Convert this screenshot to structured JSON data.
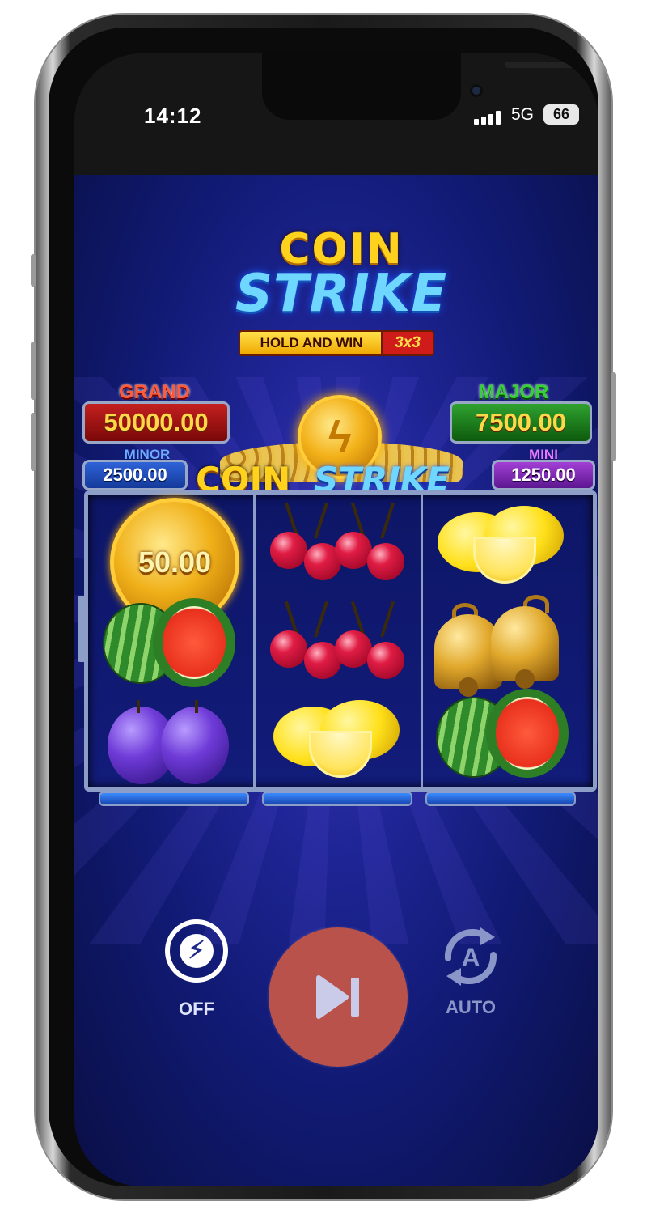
{
  "status_bar": {
    "time": "14:12",
    "network": "5G",
    "battery": "66"
  },
  "logo": {
    "word1": "COIN",
    "word2": "STRIKE",
    "tag": "HOLD AND WIN",
    "tag_badge": "3x3"
  },
  "jackpots": {
    "grand": {
      "label": "GRAND",
      "value": "50000.00"
    },
    "major": {
      "label": "MAJOR",
      "value": "7500.00"
    },
    "minor": {
      "label": "MINOR",
      "value": "2500.00"
    },
    "mini": {
      "label": "MINI",
      "value": "1250.00"
    }
  },
  "banner": {
    "word1": "COIN",
    "word2": "STRIKE"
  },
  "reels": [
    [
      "coin",
      "watermelon",
      "plums"
    ],
    [
      "cherries",
      "cherries",
      "lemons"
    ],
    [
      "lemons",
      "bells",
      "watermelon"
    ]
  ],
  "coin_value": "50.00",
  "controls": {
    "turbo_label": "OFF",
    "auto_label": "AUTO",
    "auto_icon_letter": "A"
  },
  "colors": {
    "grand": "#c42020",
    "major": "#2fa22f",
    "minor": "#2f63d8",
    "mini": "#a23fd6",
    "spin_button": "#b8524a"
  }
}
